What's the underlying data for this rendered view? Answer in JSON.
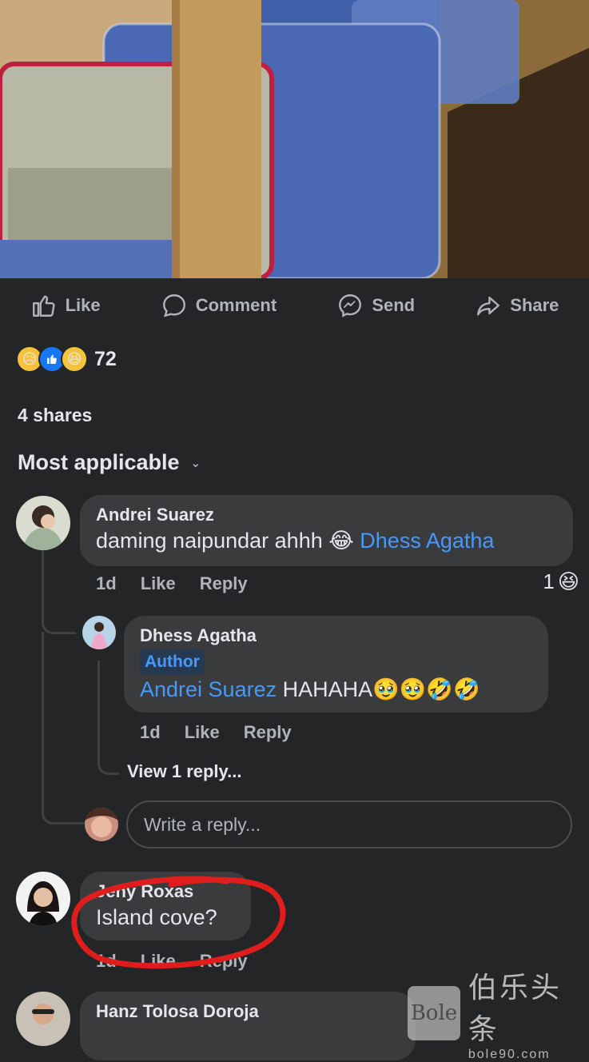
{
  "actions": {
    "like": "Like",
    "comment": "Comment",
    "send": "Send",
    "share": "Share"
  },
  "reactions": {
    "count": "72",
    "icons": [
      "sad-emoji",
      "like-thumb",
      "haha-emoji"
    ]
  },
  "shares": "4 shares",
  "sort": {
    "label": "Most applicable",
    "icon": "chevron-down-icon"
  },
  "comments": [
    {
      "author": "Andrei Suarez",
      "text": "daming naipundar ahhh 😂",
      "mention": "Dhess Agatha",
      "time": "1d",
      "like": "Like",
      "reply": "Reply",
      "reaction_count": "1",
      "reaction_icon": "😆",
      "replies": [
        {
          "author": "Dhess Agatha",
          "badge": "Author",
          "mention": "Andrei Suarez",
          "text": " HAHAHA🥹🥹🤣🤣",
          "time": "1d",
          "like": "Like",
          "reply": "Reply",
          "view_replies": "View 1 reply..."
        }
      ],
      "reply_placeholder": "Write a reply..."
    },
    {
      "author": "Jeny Roxas",
      "text": "Island cove?",
      "time": "1d",
      "like": "Like",
      "reply": "Reply"
    },
    {
      "author": "Hanz Tolosa Doroja"
    }
  ],
  "watermark": {
    "logo": "Bole",
    "chinese": "伯乐头条",
    "url": "bole90.com"
  },
  "colors": {
    "background": "#242526",
    "bubble": "#3a3b3c",
    "link": "#4599ff",
    "annotation": "#e01d1d"
  }
}
